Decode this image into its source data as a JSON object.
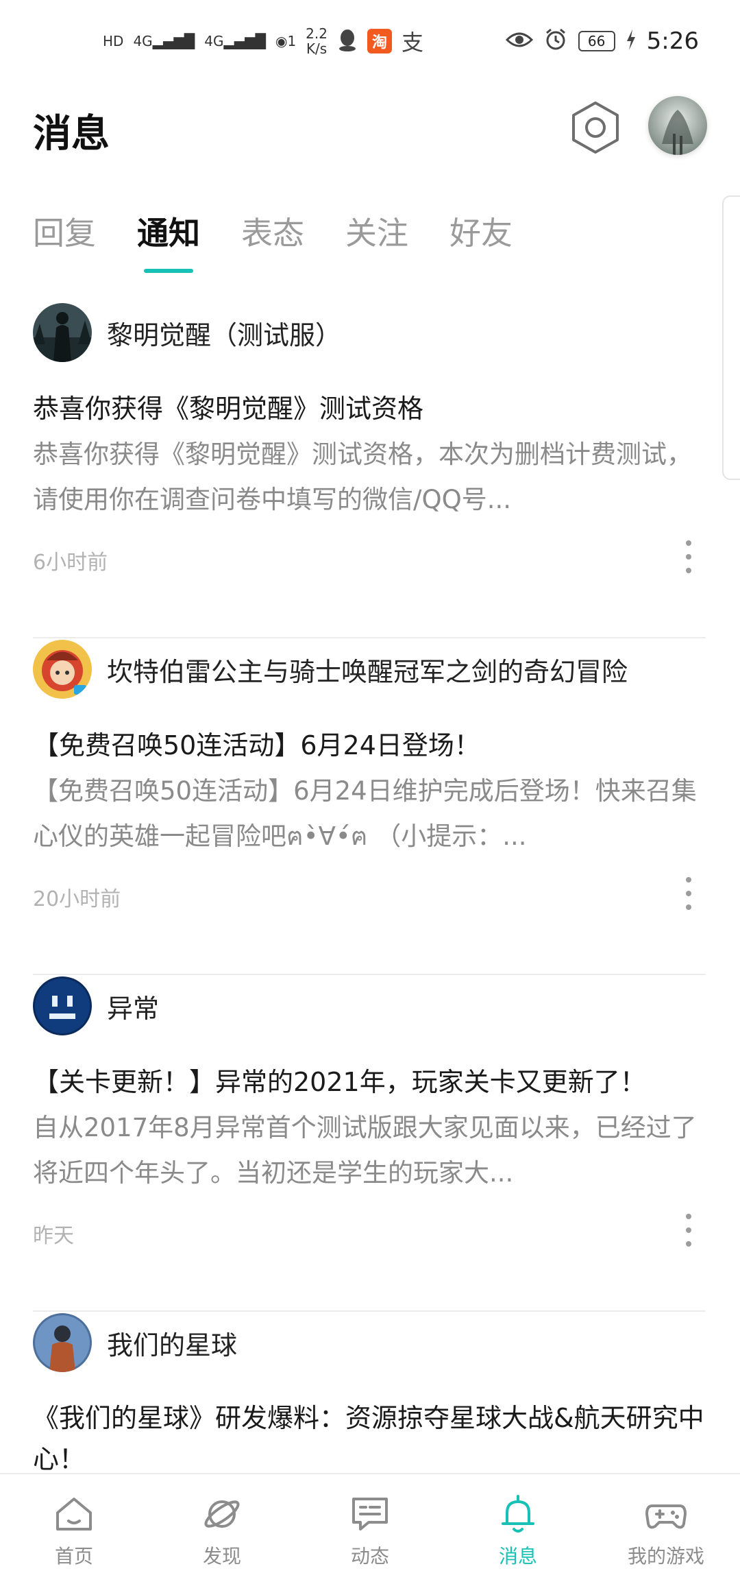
{
  "status_bar": {
    "hd_label": "HD",
    "sim1": "4G",
    "sim2": "4G",
    "hotspot_count": "1",
    "net_speed_value": "2.2",
    "net_speed_unit": "K/s",
    "taobao_glyph": "淘",
    "alipay_glyph": "支",
    "battery": "66",
    "time": "5:26"
  },
  "header": {
    "title": "消息"
  },
  "tabs": [
    {
      "label": "回复",
      "active": false
    },
    {
      "label": "通知",
      "active": true
    },
    {
      "label": "表态",
      "active": false
    },
    {
      "label": "关注",
      "active": false
    },
    {
      "label": "好友",
      "active": false
    }
  ],
  "notifications": [
    {
      "game": "黎明觉醒（测试服）",
      "title": "恭喜你获得《黎明觉醒》测试资格",
      "body": "恭喜你获得《黎明觉醒》测试资格，本次为删档计费测试，请使用你在调查问卷中填写的微信/QQ号...",
      "time": "6小时前"
    },
    {
      "game": "坎特伯雷公主与骑士唤醒冠军之剑的奇幻冒险",
      "title": "【免费召唤50连活动】6月24日登场！",
      "body": "【免费召唤50连活动】6月24日维护完成后登场！快来召集心仪的英雄一起冒险吧ฅ•̀∀•́ฅ （小提示：...",
      "time": "20小时前"
    },
    {
      "game": "异常",
      "title": "【关卡更新！】异常的2021年，玩家关卡又更新了！",
      "body": "自从2017年8月异常首个测试版跟大家见面以来，已经过了将近四个年头了。当初还是学生的玩家大...",
      "time": "昨天"
    },
    {
      "game": "我们的星球",
      "title": "《我们的星球》研发爆料：资源掠夺星球大战&航天研究中心！"
    }
  ],
  "bottom_nav": [
    {
      "label": "首页",
      "icon": "home-icon"
    },
    {
      "label": "发现",
      "icon": "planet-icon"
    },
    {
      "label": "动态",
      "icon": "chat-icon"
    },
    {
      "label": "消息",
      "icon": "bell-icon"
    },
    {
      "label": "我的游戏",
      "icon": "gamepad-icon"
    }
  ],
  "colors": {
    "accent": "#18c1b5",
    "inactive": "#9a9a9a"
  }
}
